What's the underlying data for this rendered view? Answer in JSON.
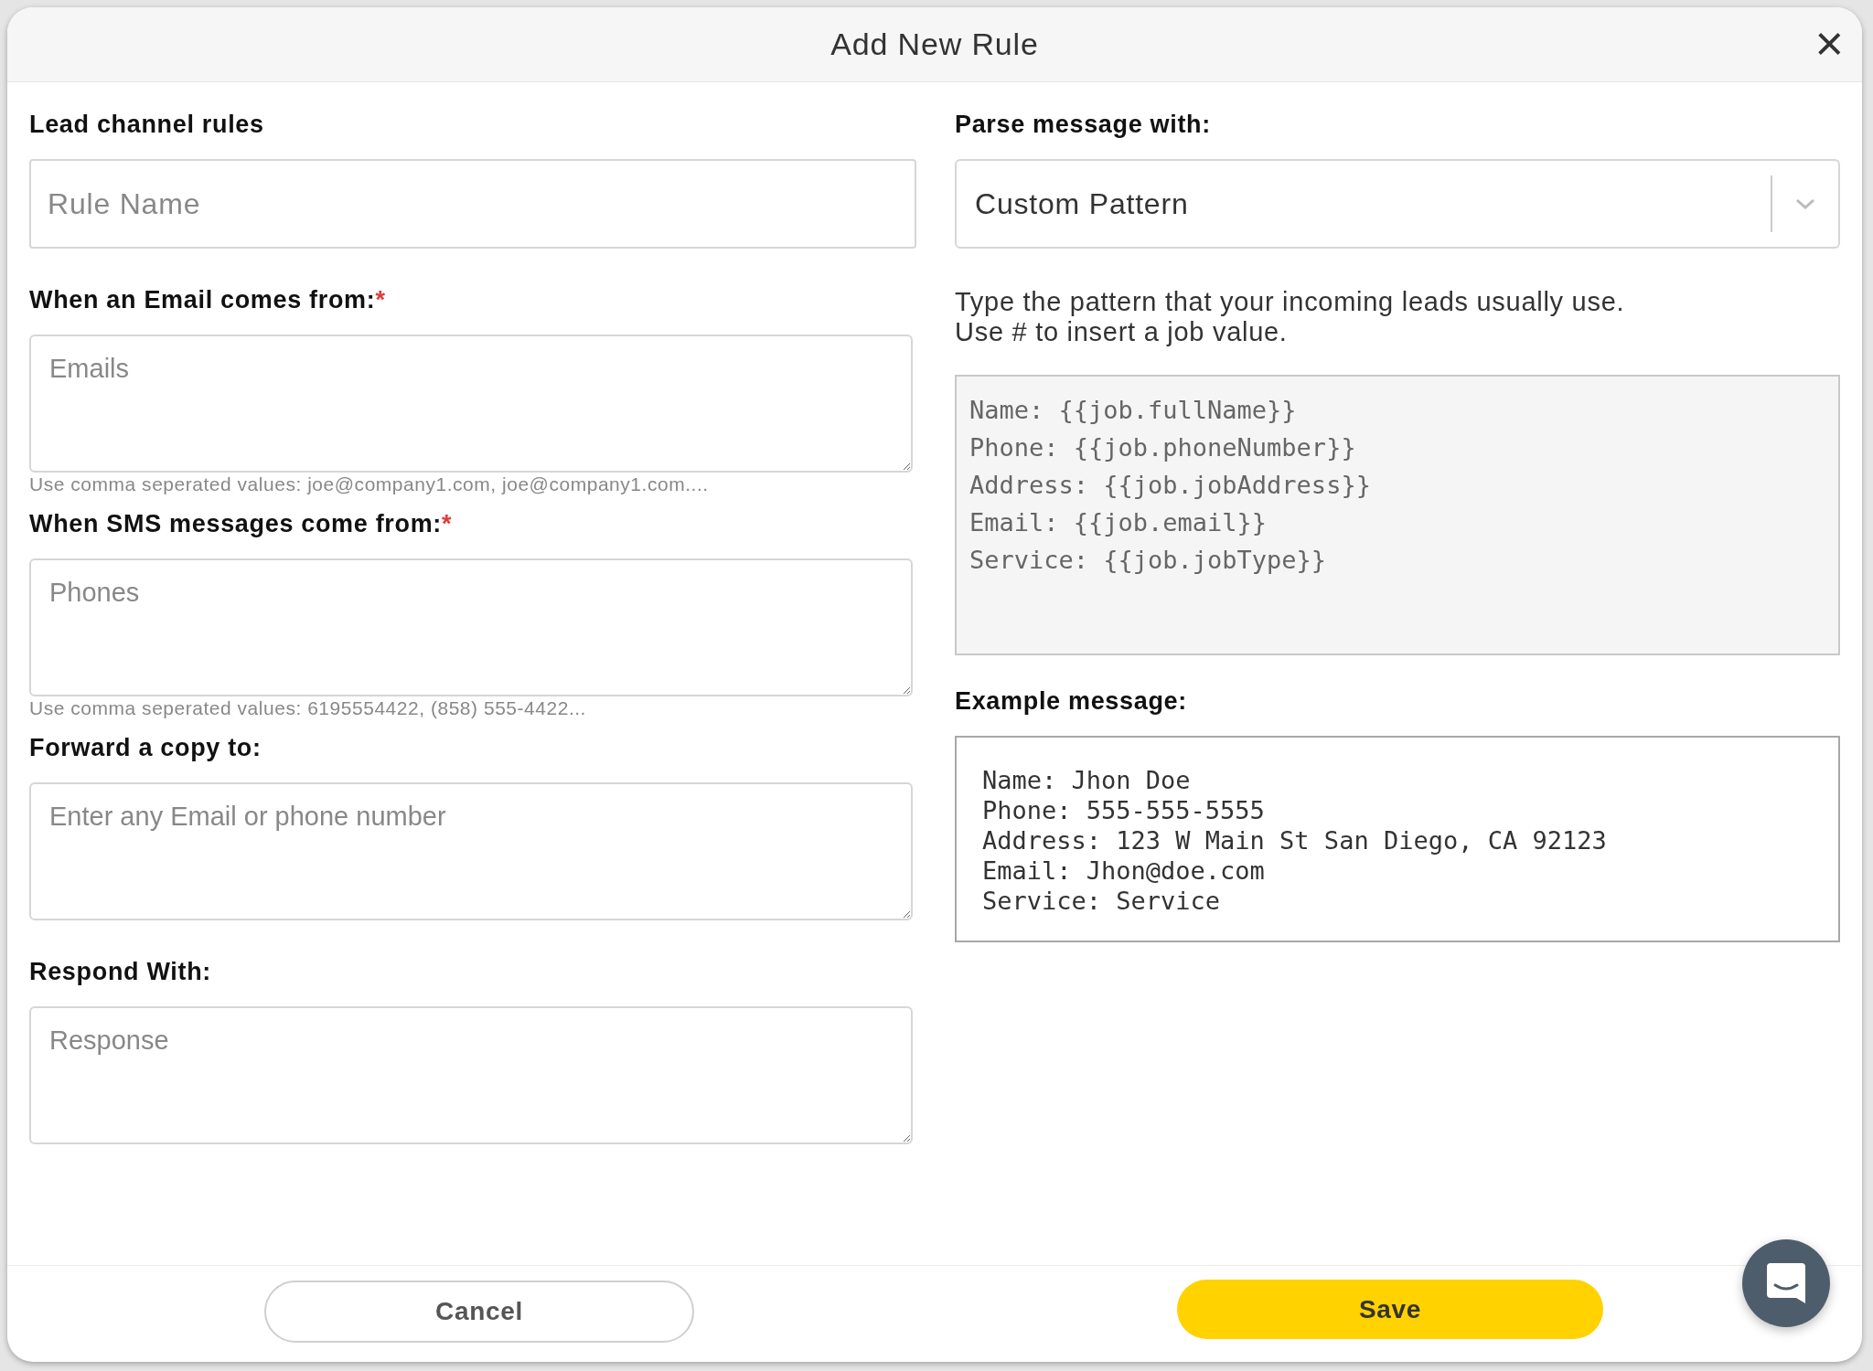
{
  "dialog": {
    "title": "Add New Rule",
    "close": "×"
  },
  "left": [
    {
      "label": "Lead channel rules",
      "kind": "input",
      "placeholder": "Rule Name"
    },
    {
      "label": "When an Email comes from:",
      "required_mark": "*",
      "kind": "textarea",
      "placeholder": "Emails",
      "hint": "Use comma seperated values: joe@company1.com, joe@company1.com...."
    },
    {
      "label": "When SMS messages come from:",
      "required_mark": "*",
      "kind": "textarea",
      "placeholder": "Phones",
      "hint": "Use comma seperated values: 6195554422, (858) 555-4422..."
    },
    {
      "label": "Forward a copy to:",
      "kind": "textarea",
      "placeholder": "Enter any Email or phone number"
    },
    {
      "label": "Respond With:",
      "kind": "textarea",
      "placeholder": "Response"
    }
  ],
  "right": {
    "parse_label": "Parse message with:",
    "parse_value": "Custom Pattern",
    "description": [
      "Type the pattern that your incoming leads usually use.",
      "Use # to insert a job value."
    ],
    "pattern_lines": [
      "Name: {{job.fullName}}",
      "Phone: {{job.phoneNumber}}",
      "Address: {{job.jobAddress}}",
      "Email: {{job.email}}",
      "Service: {{job.jobType}}"
    ],
    "example_label": "Example message:",
    "example_lines": [
      "Name: Jhon Doe",
      "Phone: 555-555-5555",
      "Address: 123 W Main St San Diego, CA 92123",
      "Email: Jhon@doe.com",
      "Service: Service"
    ]
  },
  "footer": {
    "cancel": "Cancel",
    "save": "Save"
  }
}
